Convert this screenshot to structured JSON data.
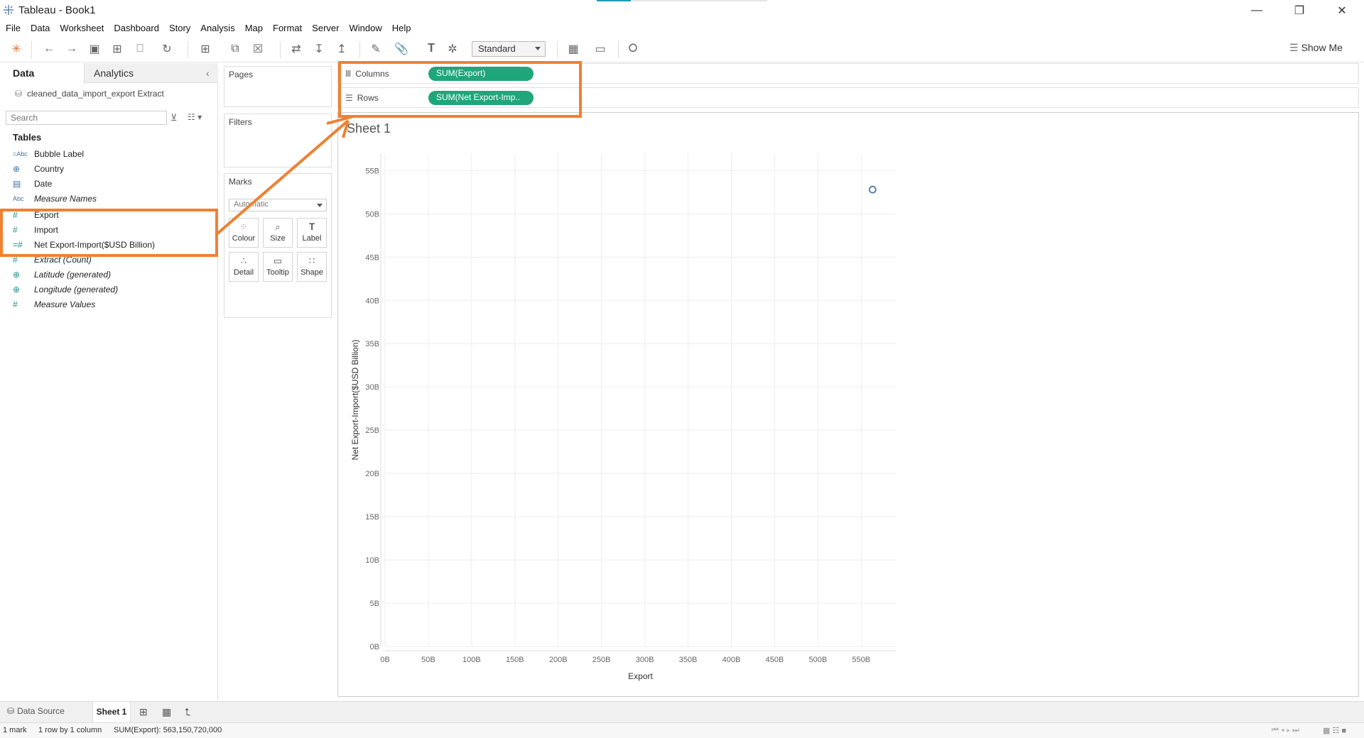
{
  "window": {
    "title": "Tableau - Book1"
  },
  "menu": [
    "File",
    "Data",
    "Worksheet",
    "Dashboard",
    "Story",
    "Analysis",
    "Map",
    "Format",
    "Server",
    "Window",
    "Help"
  ],
  "toolbar": {
    "view_select": "Standard",
    "show_me": "Show Me"
  },
  "left_pane": {
    "tab_data": "Data",
    "tab_analytics": "Analytics",
    "datasource": "cleaned_data_import_export Extract",
    "search_placeholder": "Search",
    "tables_heading": "Tables",
    "fields": [
      {
        "icon": "=Abc",
        "label": "Bubble Label",
        "italic": false
      },
      {
        "icon": "globe",
        "label": "Country",
        "italic": false
      },
      {
        "icon": "calendar",
        "label": "Date",
        "italic": false
      },
      {
        "icon": "Abc",
        "label": "Measure Names",
        "italic": true
      },
      {
        "icon": "#",
        "label": "Export",
        "italic": false
      },
      {
        "icon": "#",
        "label": "Import",
        "italic": false
      },
      {
        "icon": "=#",
        "label": "Net Export-Import($USD Billion)",
        "italic": false
      },
      {
        "icon": "#",
        "label": "Extract (Count)",
        "italic": true
      },
      {
        "icon": "globe",
        "label": "Latitude (generated)",
        "italic": true
      },
      {
        "icon": "globe",
        "label": "Longitude (generated)",
        "italic": true
      },
      {
        "icon": "#",
        "label": "Measure Values",
        "italic": true
      }
    ]
  },
  "shelves": {
    "pages": "Pages",
    "filters": "Filters",
    "marks": "Marks",
    "mark_type": "Automatic",
    "mark_buttons": [
      "Colour",
      "Size",
      "Label",
      "Detail",
      "Tooltip",
      "Shape"
    ],
    "columns_label": "Columns",
    "rows_label": "Rows",
    "columns_pill": "SUM(Export)",
    "rows_pill": "SUM(Net Export-Imp.."
  },
  "sheet": {
    "title": "Sheet 1"
  },
  "chart_data": {
    "type": "scatter",
    "xlabel": "Export",
    "ylabel": "Net Export-Import($USD Billion)",
    "x_ticks": [
      "0B",
      "50B",
      "100B",
      "150B",
      "200B",
      "250B",
      "300B",
      "350B",
      "400B",
      "450B",
      "500B",
      "550B"
    ],
    "y_ticks": [
      "0B",
      "5B",
      "10B",
      "15B",
      "20B",
      "25B",
      "30B",
      "35B",
      "40B",
      "45B",
      "50B",
      "55B"
    ],
    "xlim": [
      0,
      590
    ],
    "ylim": [
      0,
      57
    ],
    "points": [
      {
        "x": 563.15,
        "y": 52.8
      }
    ],
    "grid": true
  },
  "bottom": {
    "data_source_tab": "Data Source",
    "sheet_tab": "Sheet 1"
  },
  "status": {
    "marks": "1 mark",
    "rows_cols": "1 row by 1 column",
    "sum": "SUM(Export): 563,150,720,000"
  },
  "colors": {
    "accent_orange": "#ef8133",
    "pill_green": "#1fa67a",
    "mark_blue": "#4e79a7"
  }
}
